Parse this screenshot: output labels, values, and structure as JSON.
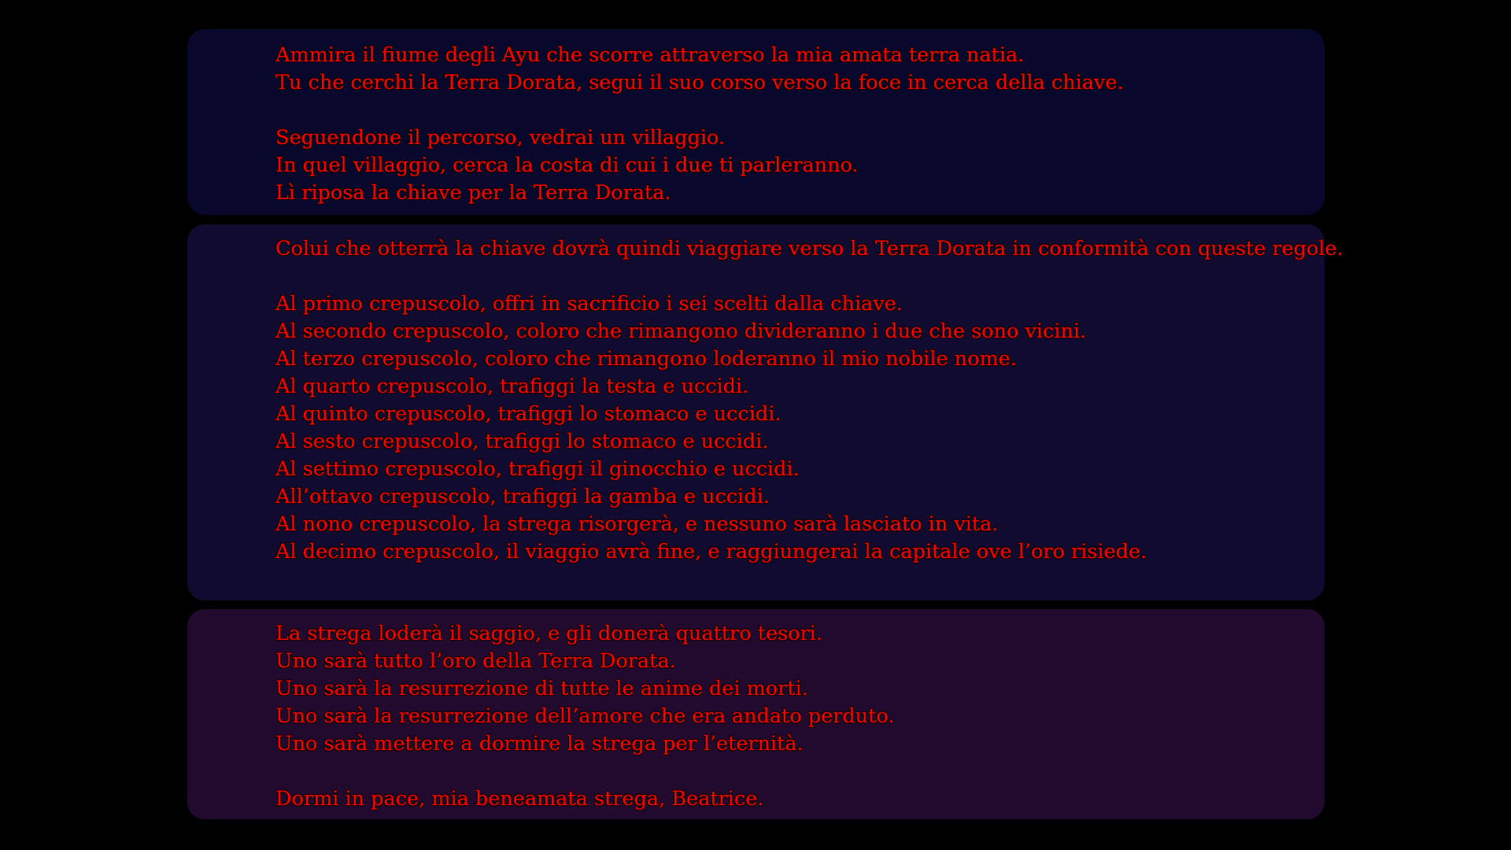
{
  "epitaph": {
    "section_1": [
      "Ammira il fiume degli Ayu che scorre attraverso la mia amata terra natia.",
      "Tu che cerchi la Terra Dorata, segui il suo corso verso la foce in cerca della chiave.",
      "",
      "Seguendone il percorso, vedrai un villaggio.",
      "In quel villaggio, cerca la costa di cui i due ti parleranno.",
      "Lì riposa la chiave per la Terra Dorata."
    ],
    "section_2": [
      "Colui che otterrà la chiave dovrà quindi viaggiare verso la Terra Dorata in conformità con queste regole.",
      "",
      "Al primo crepuscolo, offri in sacrificio i sei scelti dalla chiave.",
      "Al secondo crepuscolo, coloro che rimangono divideranno i due che sono vicini.",
      "Al terzo crepuscolo, coloro che rimangono loderanno il mio nobile nome.",
      "Al quarto crepuscolo, trafiggi la testa e uccidi.",
      "Al quinto crepuscolo, trafiggi lo stomaco e uccidi.",
      "Al sesto crepuscolo, trafiggi lo stomaco e uccidi.",
      "Al settimo crepuscolo, trafiggi il ginocchio e uccidi.",
      "All’ottavo crepuscolo, trafiggi la gamba e uccidi.",
      "Al nono crepuscolo, la strega risorgerà, e nessuno sarà lasciato in vita.",
      "Al decimo crepuscolo, il viaggio avrà fine, e raggiungerai la capitale ove l’oro risiede."
    ],
    "section_3": [
      "La strega loderà il saggio, e gli donerà quattro tesori.",
      "Uno sarà tutto l’oro della Terra Dorata.",
      "Uno sarà la resurrezione di tutte le anime dei morti.",
      "Uno sarà la resurrezione dell’amore che era andato perduto.",
      "Uno sarà mettere a dormire la strega per l’eternità.",
      "",
      "Dormi in pace, mia beneamata strega, Beatrice."
    ]
  },
  "colors": {
    "background": "#000000",
    "text": "#ff0000",
    "panel_1": "#08082c",
    "panel_2": "#110b30",
    "panel_3": "#210a2e"
  }
}
